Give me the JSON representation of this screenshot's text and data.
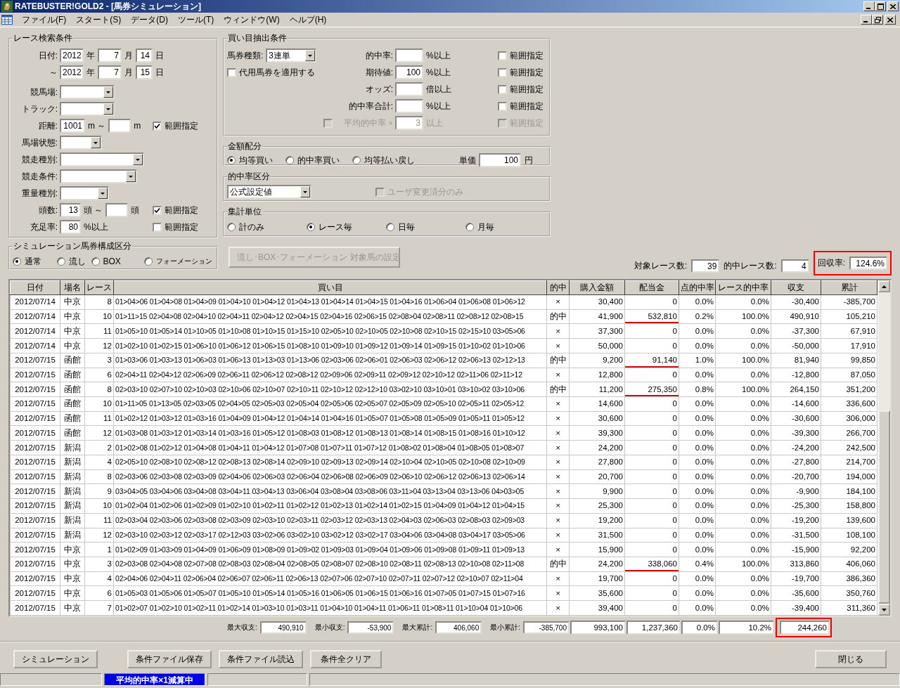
{
  "window": {
    "title": "RATEBUSTER!GOLD2 - [馬券シミュレーション]"
  },
  "menu": [
    "ファイル(F)",
    "スタート(S)",
    "データ(D)",
    "ツール(T)",
    "ウィンドウ(W)",
    "ヘルプ(H)"
  ],
  "race_search": {
    "title": "レース検索条件",
    "rows": [
      {
        "label": "日付:",
        "parts": [
          {
            "kind": "input",
            "value": "2012"
          },
          {
            "kind": "unit",
            "text": "年"
          },
          {
            "kind": "input",
            "value": "7"
          },
          {
            "kind": "unit",
            "text": "月"
          },
          {
            "kind": "input",
            "value": "14"
          },
          {
            "kind": "unit",
            "text": "日"
          }
        ]
      },
      {
        "label": "～",
        "parts": [
          {
            "kind": "input",
            "value": "2012"
          },
          {
            "kind": "unit",
            "text": "年"
          },
          {
            "kind": "input",
            "value": "7"
          },
          {
            "kind": "unit",
            "text": "月"
          },
          {
            "kind": "input",
            "value": "15"
          },
          {
            "kind": "unit",
            "text": "日"
          }
        ]
      },
      {
        "label": "競馬場:",
        "parts": [
          {
            "kind": "select"
          }
        ]
      },
      {
        "label": "トラック:",
        "parts": [
          {
            "kind": "select"
          }
        ]
      },
      {
        "label": "距離:",
        "parts": [
          {
            "kind": "input",
            "value": "1001"
          },
          {
            "kind": "unit",
            "text": "m ～"
          },
          {
            "kind": "input"
          },
          {
            "kind": "unit",
            "text": "m"
          },
          {
            "kind": "check",
            "checked": true,
            "text": "範囲指定"
          }
        ]
      },
      {
        "label": "馬場状態:",
        "parts": [
          {
            "kind": "select"
          }
        ]
      },
      {
        "label": "競走種別:",
        "parts": [
          {
            "kind": "select"
          }
        ]
      },
      {
        "label": "競走条件:",
        "parts": [
          {
            "kind": "select"
          }
        ]
      },
      {
        "label": "重量種別:",
        "parts": [
          {
            "kind": "select"
          }
        ]
      },
      {
        "label": "頭数:",
        "parts": [
          {
            "kind": "input",
            "value": "13"
          },
          {
            "kind": "unit",
            "text": "頭 ～"
          },
          {
            "kind": "input"
          },
          {
            "kind": "unit",
            "text": "頭"
          },
          {
            "kind": "check",
            "checked": true,
            "text": "範囲指定"
          }
        ]
      },
      {
        "label": "充足率:",
        "parts": [
          {
            "kind": "input",
            "value": "80"
          },
          {
            "kind": "unit",
            "text": "%以上"
          },
          {
            "kind": "check",
            "checked": false,
            "text": "範囲指定"
          }
        ]
      }
    ]
  },
  "composition": {
    "title": "シミュレーション馬券構成区分",
    "options": [
      {
        "label": "通常",
        "selected": true
      },
      {
        "label": "流し",
        "selected": false
      },
      {
        "label": "BOX",
        "selected": false
      },
      {
        "label": "フォーメーション",
        "selected": false
      }
    ]
  },
  "buy_conditions": {
    "title": "買い目抽出条件",
    "ticket_type": {
      "label": "馬券種類:",
      "value": "3連単"
    },
    "substitute": {
      "label": "代用馬券を適用する",
      "checked": false
    },
    "rows": [
      {
        "kind": "plain",
        "label": "的中率:",
        "unit": "%以上",
        "range": {
          "label": "範囲指定",
          "checked": false
        },
        "disabled": false
      },
      {
        "kind": "plain",
        "label": "期待値:",
        "value": "100",
        "unit": "%以上",
        "range": {
          "label": "範囲指定",
          "checked": false
        },
        "disabled": false
      },
      {
        "kind": "plain",
        "label": "オッズ:",
        "unit": "倍以上",
        "range": {
          "label": "範囲指定",
          "checked": false
        },
        "disabled": false
      },
      {
        "kind": "plain",
        "label": "的中率合計:",
        "unit": "%以上",
        "range": {
          "label": "範囲指定",
          "checked": false
        },
        "disabled": false
      },
      {
        "kind": "check",
        "checked": false,
        "label": "平均的中率 ×",
        "value": "3",
        "unit": "以上",
        "range": {
          "label": "範囲指定",
          "checked": false
        },
        "disabled": true
      }
    ]
  },
  "amount": {
    "title": "金額配分",
    "options": [
      {
        "label": "均等買い",
        "selected": true
      },
      {
        "label": "的中率買い",
        "selected": false
      },
      {
        "label": "均等払い戻し",
        "selected": false
      }
    ],
    "unit_price": {
      "label": "単価",
      "value": "100",
      "unit": "円"
    }
  },
  "hit_class": {
    "title": "的中率区分",
    "value": "公式設定値",
    "user_only": {
      "label": "ユーザ変更済分のみ",
      "checked": false,
      "disabled": true
    }
  },
  "aggregation": {
    "title": "集計単位",
    "options": [
      {
        "label": "計のみ",
        "selected": false
      },
      {
        "label": "レース毎",
        "selected": true
      },
      {
        "label": "日毎",
        "selected": false
      },
      {
        "label": "月毎",
        "selected": false
      }
    ]
  },
  "target_button": {
    "label": "流し･BOX･フォーメーション 対象馬の設定",
    "disabled": true
  },
  "counts": [
    {
      "label": "対象レース数:",
      "value": "39"
    },
    {
      "label": "的中レース数:",
      "value": "4"
    }
  ],
  "recovery_rate": {
    "label": "回収率:",
    "value": "124.6%",
    "annotated": true
  },
  "table": {
    "columns": [
      "日付",
      "場名",
      "レース",
      "買い目",
      "的中",
      "購入金額",
      "配当金",
      "点的中率",
      "レース的中率",
      "収支",
      "累計"
    ],
    "rows": [
      {
        "date": "2012/07/14",
        "venue": "中京",
        "race": "8",
        "bets": "01>04>06 01>04>08 01>04>09 01>04>10 01>04>12 01>04>13 01>04>14 01>04>15 01>04>16 01>06>04 01>06>08 01>06>12",
        "result": "×",
        "purchase": "30,400",
        "payout": "0",
        "marked": false,
        "point_rate": "0.0%",
        "race_rate": "0.0%",
        "balance": "-30,400",
        "cumulative": "-385,700"
      },
      {
        "date": "2012/07/14",
        "venue": "中京",
        "race": "10",
        "bets": "01>11>15 02>04>08 02>04>10 02>04>11 02>04>12 02>04>15 02>04>16 02>06>15 02>08>04 02>08>11 02>08>12 02>08>15",
        "result": "的中",
        "purchase": "41,900",
        "payout": "532,810",
        "marked": true,
        "point_rate": "0.2%",
        "race_rate": "100.0%",
        "balance": "490,910",
        "cumulative": "105,210"
      },
      {
        "date": "2012/07/14",
        "venue": "中京",
        "race": "11",
        "bets": "01>05>10 01>05>14 01>10>05 01>10>08 01>10>15 01>15>10 02>05>10 02>10>05 02>10>08 02>10>15 02>15>10 03>05>06",
        "result": "×",
        "purchase": "37,300",
        "payout": "0",
        "marked": false,
        "point_rate": "0.0%",
        "race_rate": "0.0%",
        "balance": "-37,300",
        "cumulative": "67,910"
      },
      {
        "date": "2012/07/14",
        "venue": "中京",
        "race": "12",
        "bets": "01>02>10 01>02>15 01>06>10 01>06>12 01>06>15 01>08>10 01>09>10 01>09>12 01>09>14 01>09>15 01>10>02 01>10>06",
        "result": "×",
        "purchase": "50,000",
        "payout": "0",
        "marked": false,
        "point_rate": "0.0%",
        "race_rate": "0.0%",
        "balance": "-50,000",
        "cumulative": "17,910"
      },
      {
        "date": "2012/07/15",
        "venue": "函館",
        "race": "3",
        "bets": "01>03>06 01>03>13 01>06>03 01>06>13 01>13>03 01>13>06 02>03>06 02>06>01 02>06>03 02>06>12 02>06>13 02>12>13",
        "result": "的中",
        "purchase": "9,200",
        "payout": "91,140",
        "marked": true,
        "point_rate": "1.0%",
        "race_rate": "100.0%",
        "balance": "81,940",
        "cumulative": "99,850"
      },
      {
        "date": "2012/07/15",
        "venue": "函館",
        "race": "6",
        "bets": "02>04>11 02>04>12 02>06>09 02>06>11 02>06>12 02>08>12 02>09>06 02>09>11 02>09>12 02>10>12 02>11>06 02>11>12",
        "result": "×",
        "purchase": "12,800",
        "payout": "0",
        "marked": false,
        "point_rate": "0.0%",
        "race_rate": "0.0%",
        "balance": "-12,800",
        "cumulative": "87,050"
      },
      {
        "date": "2012/07/15",
        "venue": "函館",
        "race": "8",
        "bets": "02>03>10 02>07>10 02>10>03 02>10>06 02>10>07 02>10>11 02>10>12 02>12>10 03>02>10 03>10>01 03>10>02 03>10>06",
        "result": "的中",
        "purchase": "11,200",
        "payout": "275,350",
        "marked": true,
        "point_rate": "0.8%",
        "race_rate": "100.0%",
        "balance": "264,150",
        "cumulative": "351,200"
      },
      {
        "date": "2012/07/15",
        "venue": "函館",
        "race": "10",
        "bets": "01>11>05 01>13>05 02>03>05 02>04>05 02>05>03 02>05>04 02>05>06 02>05>07 02>05>09 02>05>10 02>05>11 02>05>12",
        "result": "×",
        "purchase": "14,600",
        "payout": "0",
        "marked": false,
        "point_rate": "0.0%",
        "race_rate": "0.0%",
        "balance": "-14,600",
        "cumulative": "336,600"
      },
      {
        "date": "2012/07/15",
        "venue": "函館",
        "race": "11",
        "bets": "01>02>12 01>03>12 01>03>16 01>04>09 01>04>12 01>04>14 01>04>16 01>05>07 01>05>08 01>05>09 01>05>11 01>05>12",
        "result": "×",
        "purchase": "30,600",
        "payout": "0",
        "marked": false,
        "point_rate": "0.0%",
        "race_rate": "0.0%",
        "balance": "-30,600",
        "cumulative": "306,000"
      },
      {
        "date": "2012/07/15",
        "venue": "函館",
        "race": "12",
        "bets": "01>03>08 01>03>12 01>03>14 01>03>16 01>05>12 01>08>03 01>08>12 01>08>13 01>08>14 01>08>15 01>08>16 01>10>12",
        "result": "×",
        "purchase": "39,300",
        "payout": "0",
        "marked": false,
        "point_rate": "0.0%",
        "race_rate": "0.0%",
        "balance": "-39,300",
        "cumulative": "266,700"
      },
      {
        "date": "2012/07/15",
        "venue": "新潟",
        "race": "2",
        "bets": "01>02>08 01>02>12 01>04>08 01>04>11 01>04>12 01>07>08 01>07>11 01>07>12 01>08>02 01>08>04 01>08>05 01>08>07",
        "result": "×",
        "purchase": "24,200",
        "payout": "0",
        "marked": false,
        "point_rate": "0.0%",
        "race_rate": "0.0%",
        "balance": "-24,200",
        "cumulative": "242,500"
      },
      {
        "date": "2012/07/15",
        "venue": "新潟",
        "race": "4",
        "bets": "02>05>10 02>08>10 02>08>12 02>08>13 02>08>14 02>09>10 02>09>13 02>09>14 02>10>04 02>10>05 02>10>08 02>10>09",
        "result": "×",
        "purchase": "27,800",
        "payout": "0",
        "marked": false,
        "point_rate": "0.0%",
        "race_rate": "0.0%",
        "balance": "-27,800",
        "cumulative": "214,700"
      },
      {
        "date": "2012/07/15",
        "venue": "新潟",
        "race": "8",
        "bets": "02>03>06 02>03>08 02>03>09 02>04>06 02>06>03 02>06>04 02>06>08 02>06>09 02>06>10 02>06>12 02>06>13 02>06>14",
        "result": "×",
        "purchase": "20,700",
        "payout": "0",
        "marked": false,
        "point_rate": "0.0%",
        "race_rate": "0.0%",
        "balance": "-20,700",
        "cumulative": "194,000"
      },
      {
        "date": "2012/07/15",
        "venue": "新潟",
        "race": "9",
        "bets": "03>04>05 03>04>06 03>04>08 03>04>11 03>04>13 03>06>04 03>08>04 03>08>06 03>11>04 03>13>04 03>13>06 04>03>05",
        "result": "×",
        "purchase": "9,900",
        "payout": "0",
        "marked": false,
        "point_rate": "0.0%",
        "race_rate": "0.0%",
        "balance": "-9,900",
        "cumulative": "184,100"
      },
      {
        "date": "2012/07/15",
        "venue": "新潟",
        "race": "10",
        "bets": "01>02>04 01>02>06 01>02>09 01>02>10 01>02>11 01>02>12 01>02>13 01>02>14 01>02>15 01>04>09 01>04>12 01>04>15",
        "result": "×",
        "purchase": "25,300",
        "payout": "0",
        "marked": false,
        "point_rate": "0.0%",
        "race_rate": "0.0%",
        "balance": "-25,300",
        "cumulative": "158,800"
      },
      {
        "date": "2012/07/15",
        "venue": "新潟",
        "race": "11",
        "bets": "02>03>04 02>03>06 02>03>08 02>03>09 02>03>10 02>03>11 02>03>12 02>03>13 02>04>03 02>06>03 02>08>03 02>09>03",
        "result": "×",
        "purchase": "19,200",
        "payout": "0",
        "marked": false,
        "point_rate": "0.0%",
        "race_rate": "0.0%",
        "balance": "-19,200",
        "cumulative": "139,600"
      },
      {
        "date": "2012/07/15",
        "venue": "新潟",
        "race": "12",
        "bets": "02>03>10 02>03>12 02>03>17 02>12>03 03>02>06 03>02>10 03>02>12 03>02>17 03>04>06 03>04>08 03>04>17 03>05>06",
        "result": "×",
        "purchase": "31,500",
        "payout": "0",
        "marked": false,
        "point_rate": "0.0%",
        "race_rate": "0.0%",
        "balance": "-31,500",
        "cumulative": "108,100"
      },
      {
        "date": "2012/07/15",
        "venue": "中京",
        "race": "1",
        "bets": "01>02>09 01>03>09 01>04>09 01>06>09 01>08>09 01>09>02 01>09>03 01>09>04 01>09>06 01>09>08 01>09>11 01>09>13",
        "result": "×",
        "purchase": "15,900",
        "payout": "0",
        "marked": false,
        "point_rate": "0.0%",
        "race_rate": "0.0%",
        "balance": "-15,900",
        "cumulative": "92,200"
      },
      {
        "date": "2012/07/15",
        "venue": "中京",
        "race": "3",
        "bets": "02>03>08 02>04>08 02>07>08 02>08>03 02>08>04 02>08>05 02>08>07 02>08>10 02>08>11 02>08>13 02>10>08 02>11>08",
        "result": "的中",
        "purchase": "24,200",
        "payout": "338,060",
        "marked": true,
        "point_rate": "0.4%",
        "race_rate": "100.0%",
        "balance": "313,860",
        "cumulative": "406,060"
      },
      {
        "date": "2012/07/15",
        "venue": "中京",
        "race": "4",
        "bets": "02>04>06 02>04>11 02>06>04 02>06>07 02>06>11 02>06>13 02>07>06 02>07>10 02>07>11 02>07>12 02>10>07 02>11>04",
        "result": "×",
        "purchase": "19,700",
        "payout": "0",
        "marked": false,
        "point_rate": "0.0%",
        "race_rate": "0.0%",
        "balance": "-19,700",
        "cumulative": "386,360"
      },
      {
        "date": "2012/07/15",
        "venue": "中京",
        "race": "6",
        "bets": "01>05>03 01>05>06 01>05>07 01>05>10 01>05>14 01>05>16 01>06>05 01>06>15 01>06>16 01>07>05 01>07>15 01>07>16",
        "result": "×",
        "purchase": "35,600",
        "payout": "0",
        "marked": false,
        "point_rate": "0.0%",
        "race_rate": "0.0%",
        "balance": "-35,600",
        "cumulative": "350,760"
      },
      {
        "date": "2012/07/15",
        "venue": "中京",
        "race": "7",
        "bets": "01>02>07 01>02>10 01>02>11 01>02>14 01>03>10 01>03>11 01>04>10 01>04>11 01>06>11 01>08>11 01>10>04 01>10>06",
        "result": "×",
        "purchase": "39,400",
        "payout": "0",
        "marked": false,
        "point_rate": "0.0%",
        "race_rate": "0.0%",
        "balance": "-39,400",
        "cumulative": "311,360"
      }
    ]
  },
  "summary": {
    "stats": [
      {
        "label": "最大収支:",
        "value": "490,910"
      },
      {
        "label": "最小収支:",
        "value": "-53,900"
      },
      {
        "label": "最大累計:",
        "value": "406,060"
      },
      {
        "label": "最小累計:",
        "value": "-385,700"
      }
    ],
    "totals": [
      "993,100",
      "1,237,360",
      "0.0%",
      "10.2%"
    ],
    "total_balance": {
      "value": "244,260",
      "annotated": true
    }
  },
  "buttons": [
    "シミュレーション",
    "条件ファイル保存",
    "条件ファイル読込",
    "条件全クリア"
  ],
  "close_button": "閉じる",
  "status_bar": {
    "message": "平均的中率×1減算中"
  }
}
